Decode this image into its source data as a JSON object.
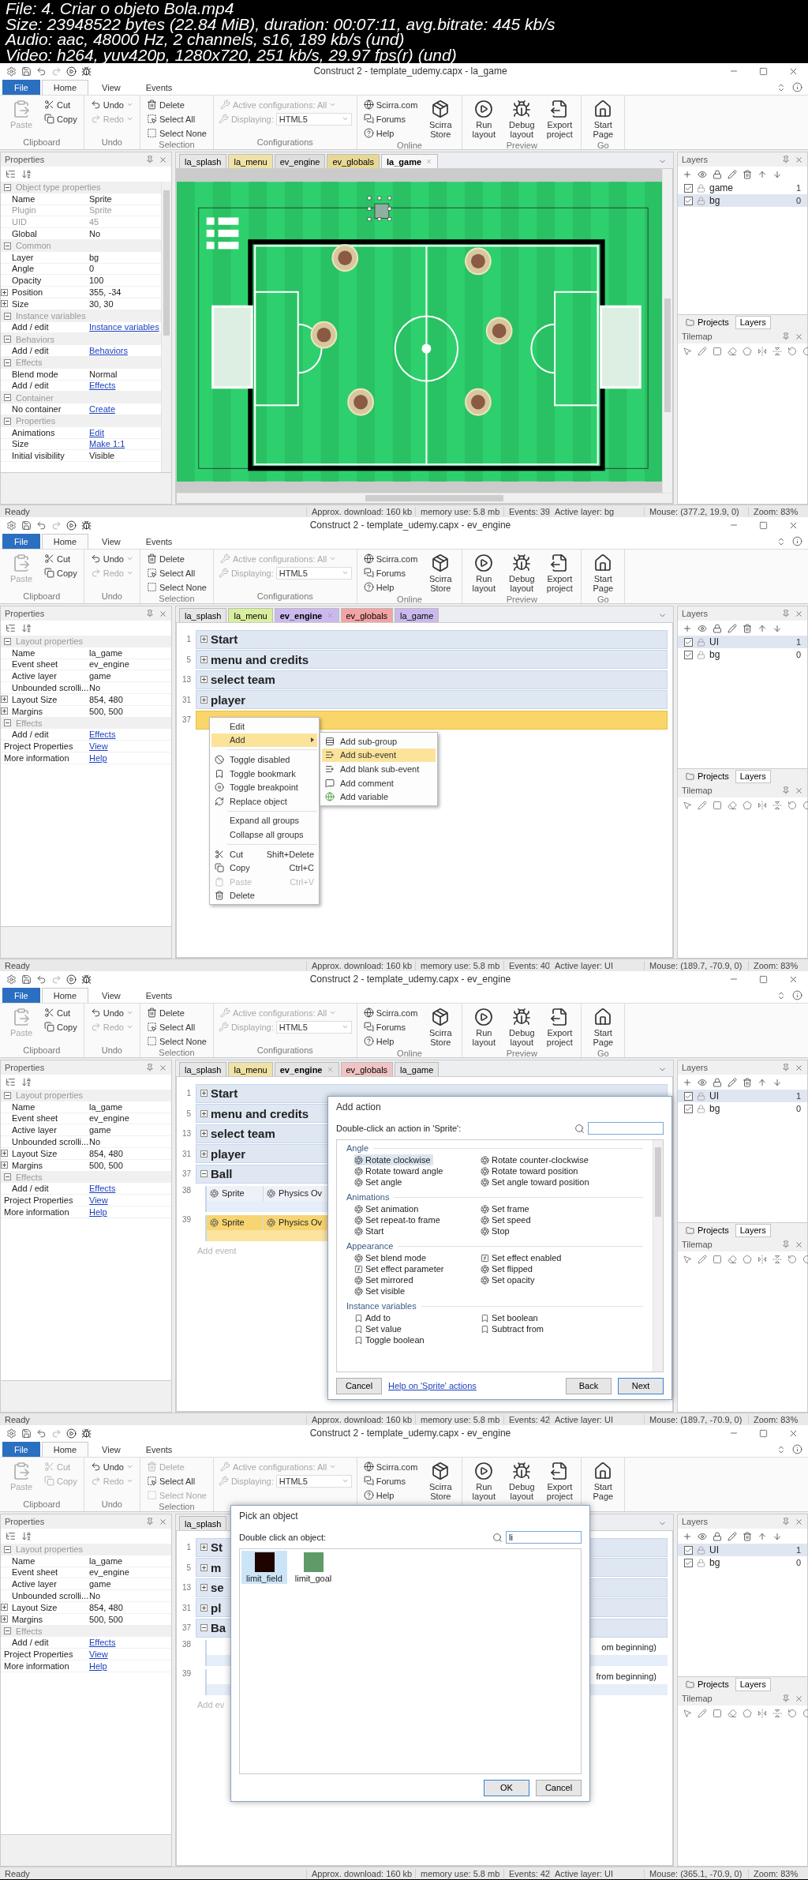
{
  "file_info": [
    "File: 4. Criar o objeto Bola.mp4",
    "Size: 23948522 bytes (22.84 MiB), duration: 00:07:11, avg.bitrate: 445 kb/s",
    "Audio: aac, 48000 Hz, 2 channels, s16, 189 kb/s (und)",
    "Video: h264, yuv420p, 1280x720, 251 kb/s, 29.97 fps(r) (und)"
  ],
  "frames": [
    {
      "window_title": "Construct 2 - template_udemy.capx - la_game",
      "ribbon_tabs": [
        {
          "label": "File",
          "selected": false
        },
        {
          "label": "Home",
          "selected": true
        },
        {
          "label": "View",
          "selected": false
        },
        {
          "label": "Events",
          "selected": false
        }
      ],
      "ribbon": [
        {
          "label": "Clipboard",
          "items": [
            {
              "kind": "large",
              "label": "Paste",
              "disabled": true
            },
            {
              "kind": "small",
              "label": "Cut",
              "disabled": false
            },
            {
              "kind": "small",
              "label": "Copy",
              "disabled": false
            }
          ]
        },
        {
          "label": "Undo",
          "items": [
            {
              "kind": "menu",
              "label": "Undo",
              "disabled": false
            },
            {
              "kind": "menu",
              "label": "Redo",
              "disabled": true
            }
          ]
        },
        {
          "label": "Selection",
          "items": [
            {
              "kind": "small",
              "label": "Delete",
              "disabled": false
            },
            {
              "kind": "small",
              "label": "Select All",
              "disabled": false
            },
            {
              "kind": "small",
              "label": "Select None",
              "disabled": false
            }
          ]
        },
        {
          "label": "Configurations",
          "items": [
            {
              "kind": "menu",
              "label": "Active configurations: All",
              "disabled": true
            },
            {
              "kind": "select",
              "label": "Displaying:",
              "value": "HTML5",
              "disabled": true
            }
          ]
        },
        {
          "label": "Online",
          "items": [
            {
              "kind": "small",
              "label": "Scirra.com",
              "disabled": false
            },
            {
              "kind": "small",
              "label": "Forums",
              "disabled": false
            },
            {
              "kind": "small",
              "label": "Help",
              "disabled": false
            },
            {
              "kind": "large",
              "label": "Scirra Store",
              "disabled": false
            }
          ]
        },
        {
          "label": "Preview",
          "items": [
            {
              "kind": "large",
              "label": "Run layout",
              "disabled": false
            },
            {
              "kind": "large",
              "label": "Debug layout",
              "disabled": false
            },
            {
              "kind": "large",
              "label": "Export project",
              "disabled": false
            }
          ]
        },
        {
          "label": "Go",
          "items": [
            {
              "kind": "large",
              "label": "Start Page",
              "disabled": false
            }
          ]
        }
      ],
      "properties": {
        "title": "Properties",
        "rows": [
          {
            "kind": "section",
            "name": "Object type properties"
          },
          {
            "kind": "row",
            "name": "Name",
            "value": "Sprite"
          },
          {
            "kind": "readonly",
            "name": "Plugin",
            "value": "Sprite"
          },
          {
            "kind": "readonly",
            "name": "UID",
            "value": "45"
          },
          {
            "kind": "row",
            "name": "Global",
            "value": "No"
          },
          {
            "kind": "section",
            "name": "Common"
          },
          {
            "kind": "row",
            "name": "Layer",
            "value": "bg"
          },
          {
            "kind": "row",
            "name": "Angle",
            "value": "0"
          },
          {
            "kind": "row",
            "name": "Opacity",
            "value": "100"
          },
          {
            "kind": "expand",
            "name": "Position",
            "value": "355, -34"
          },
          {
            "kind": "expand",
            "name": "Size",
            "value": "30, 30"
          },
          {
            "kind": "section",
            "name": "Instance variables"
          },
          {
            "kind": "link",
            "name": "Add / edit",
            "value": "Instance variables"
          },
          {
            "kind": "section",
            "name": "Behaviors"
          },
          {
            "kind": "link",
            "name": "Add / edit",
            "value": "Behaviors"
          },
          {
            "kind": "section",
            "name": "Effects"
          },
          {
            "kind": "row",
            "name": "Blend mode",
            "value": "Normal"
          },
          {
            "kind": "link",
            "name": "Add / edit",
            "value": "Effects"
          },
          {
            "kind": "section",
            "name": "Container"
          },
          {
            "kind": "link",
            "name": "No container",
            "value": "Create"
          },
          {
            "kind": "section",
            "name": "Properties"
          },
          {
            "kind": "link",
            "name": "Animations",
            "value": "Edit"
          },
          {
            "kind": "link",
            "name": "Size",
            "value": "Make 1:1"
          },
          {
            "kind": "row",
            "name": "Initial visibility",
            "value": "Visible"
          }
        ]
      },
      "document_tabs": [
        {
          "label": "la_splash",
          "color": "#e6e6e6",
          "selected": false
        },
        {
          "label": "la_menu",
          "color": "#efe2a6",
          "selected": false
        },
        {
          "label": "ev_engine",
          "color": "#dedede",
          "selected": false
        },
        {
          "label": "ev_globals",
          "color": "#e8d896",
          "selected": false
        },
        {
          "label": "la_game",
          "color": "#f7f7f7",
          "selected": true
        }
      ],
      "view": {
        "kind": "layout"
      },
      "layers": {
        "title": "Layers",
        "rows": [
          {
            "name": "game",
            "index": "1",
            "checked": true,
            "selected": false
          },
          {
            "name": "bg",
            "index": "0",
            "checked": true,
            "selected": true
          }
        ],
        "tabs": [
          {
            "label": "Projects",
            "selected": false
          },
          {
            "label": "Layers",
            "selected": true
          }
        ],
        "tilemap": "Tilemap"
      },
      "status": {
        "ready": "Ready",
        "download": "Approx. download: 160 kb",
        "memory": "memory use: 5.8 mb",
        "events": "Events: 39",
        "layer": "Active layer: bg",
        "mouse": "Mouse: (377.2, 19.9, 0)",
        "zoom": "Zoom: 83%"
      }
    },
    {
      "window_title": "Construct 2 - template_udemy.capx - ev_engine",
      "ribbon_tabs": [
        {
          "label": "File",
          "selected": false
        },
        {
          "label": "Home",
          "selected": true
        },
        {
          "label": "View",
          "selected": false
        },
        {
          "label": "Events",
          "selected": false
        }
      ],
      "ribbon": [
        {
          "label": "Clipboard",
          "items": [
            {
              "kind": "large",
              "label": "Paste",
              "disabled": true
            },
            {
              "kind": "small",
              "label": "Cut",
              "disabled": false
            },
            {
              "kind": "small",
              "label": "Copy",
              "disabled": false
            }
          ]
        },
        {
          "label": "Undo",
          "items": [
            {
              "kind": "menu",
              "label": "Undo",
              "disabled": false
            },
            {
              "kind": "menu",
              "label": "Redo",
              "disabled": true
            }
          ]
        },
        {
          "label": "Selection",
          "items": [
            {
              "kind": "small",
              "label": "Delete",
              "disabled": false
            },
            {
              "kind": "small",
              "label": "Select All",
              "disabled": false
            },
            {
              "kind": "small",
              "label": "Select None",
              "disabled": false
            }
          ]
        },
        {
          "label": "Configurations",
          "items": [
            {
              "kind": "menu",
              "label": "Active configurations: All",
              "disabled": true
            },
            {
              "kind": "select",
              "label": "Displaying:",
              "value": "HTML5",
              "disabled": true
            }
          ]
        },
        {
          "label": "Online",
          "items": [
            {
              "kind": "small",
              "label": "Scirra.com",
              "disabled": false
            },
            {
              "kind": "small",
              "label": "Forums",
              "disabled": false
            },
            {
              "kind": "small",
              "label": "Help",
              "disabled": false
            },
            {
              "kind": "large",
              "label": "Scirra Store",
              "disabled": false
            }
          ]
        },
        {
          "label": "Preview",
          "items": [
            {
              "kind": "large",
              "label": "Run layout",
              "disabled": false
            },
            {
              "kind": "large",
              "label": "Debug layout",
              "disabled": false
            },
            {
              "kind": "large",
              "label": "Export project",
              "disabled": false
            }
          ]
        },
        {
          "label": "Go",
          "items": [
            {
              "kind": "large",
              "label": "Start Page",
              "disabled": false
            }
          ]
        }
      ],
      "properties": {
        "title": "Properties",
        "rows": [
          {
            "kind": "section",
            "name": "Layout properties"
          },
          {
            "kind": "row",
            "name": "Name",
            "value": "la_game"
          },
          {
            "kind": "row",
            "name": "Event sheet",
            "value": "ev_engine"
          },
          {
            "kind": "row",
            "name": "Active layer",
            "value": "game"
          },
          {
            "kind": "row",
            "name": "Unbounded scrolli...",
            "value": "No"
          },
          {
            "kind": "expand",
            "name": "Layout Size",
            "value": "854, 480"
          },
          {
            "kind": "expand",
            "name": "Margins",
            "value": "500, 500"
          },
          {
            "kind": "section",
            "name": "Effects"
          },
          {
            "kind": "link",
            "name": "Add / edit",
            "value": "Effects"
          },
          {
            "kind": "toplink",
            "name": "Project Properties",
            "value": "View"
          },
          {
            "kind": "toplink",
            "name": "More information",
            "value": "Help"
          }
        ]
      },
      "document_tabs": [
        {
          "label": "la_splash",
          "color": "#e6e6e6",
          "selected": false
        },
        {
          "label": "la_menu",
          "color": "#d8ef9e",
          "selected": false
        },
        {
          "label": "ev_engine",
          "color": "#cbb9ee",
          "selected": true
        },
        {
          "label": "ev_globals",
          "color": "#f2a3a3",
          "selected": false
        },
        {
          "label": "la_game",
          "color": "#cbb9ee",
          "selected": false
        }
      ],
      "view": {
        "kind": "events",
        "events": [
          {
            "kind": "group",
            "line": "1",
            "title": "Start",
            "expanded": false,
            "selected": false
          },
          {
            "kind": "group",
            "line": "5",
            "title": "menu and credits",
            "expanded": false,
            "selected": false
          },
          {
            "kind": "group",
            "line": "13",
            "title": "select team",
            "expanded": false,
            "selected": false
          },
          {
            "kind": "group",
            "line": "31",
            "title": "player",
            "expanded": false,
            "selected": false
          },
          {
            "kind": "group",
            "line": "37",
            "selected": true
          }
        ]
      },
      "context_menu": {
        "items": [
          {
            "kind": "item",
            "label": "Edit",
            "selected": false,
            "disabled": false
          },
          {
            "kind": "submenu",
            "label": "Add",
            "selected": true,
            "disabled": false
          },
          {
            "kind": "separator"
          },
          {
            "kind": "item",
            "label": "Toggle disabled",
            "selected": false,
            "disabled": false
          },
          {
            "kind": "item",
            "label": "Toggle bookmark",
            "selected": false,
            "disabled": false
          },
          {
            "kind": "item",
            "label": "Toggle breakpoint",
            "selected": false,
            "disabled": false
          },
          {
            "kind": "item",
            "label": "Replace object",
            "selected": false,
            "disabled": false
          },
          {
            "kind": "separator"
          },
          {
            "kind": "item",
            "label": "Expand all groups",
            "selected": false,
            "disabled": false
          },
          {
            "kind": "item",
            "label": "Collapse all groups",
            "selected": false,
            "disabled": false
          },
          {
            "kind": "separator"
          },
          {
            "kind": "item",
            "label": "Cut",
            "shortcut": "Shift+Delete",
            "selected": false,
            "disabled": false
          },
          {
            "kind": "item",
            "label": "Copy",
            "shortcut": "Ctrl+C",
            "selected": false,
            "disabled": false
          },
          {
            "kind": "item",
            "label": "Paste",
            "shortcut": "Ctrl+V",
            "selected": false,
            "disabled": true
          },
          {
            "kind": "item",
            "label": "Delete",
            "selected": false,
            "disabled": false
          }
        ],
        "submenu": [
          {
            "label": "Add sub-group",
            "selected": false
          },
          {
            "label": "Add sub-event",
            "selected": true
          },
          {
            "label": "Add blank sub-event",
            "selected": false
          },
          {
            "label": "Add comment",
            "selected": false
          },
          {
            "label": "Add variable",
            "selected": false
          }
        ]
      },
      "layers": {
        "title": "Layers",
        "rows": [
          {
            "name": "UI",
            "index": "1",
            "checked": true,
            "selected": true
          },
          {
            "name": "bg",
            "index": "0",
            "checked": true,
            "selected": false
          }
        ],
        "tabs": [
          {
            "label": "Projects",
            "selected": false
          },
          {
            "label": "Layers",
            "selected": true
          }
        ],
        "tilemap": "Tilemap"
      },
      "status": {
        "ready": "Ready",
        "download": "Approx. download: 160 kb",
        "memory": "memory use: 5.8 mb",
        "events": "Events: 40",
        "layer": "Active layer: UI",
        "mouse": "Mouse: (189.7, -70.9, 0)",
        "zoom": "Zoom: 83%"
      }
    },
    {
      "window_title": "Construct 2 - template_udemy.capx - ev_engine",
      "ribbon_tabs": [
        {
          "label": "File",
          "selected": false
        },
        {
          "label": "Home",
          "selected": true
        },
        {
          "label": "View",
          "selected": false
        },
        {
          "label": "Events",
          "selected": false
        }
      ],
      "ribbon": [
        {
          "label": "Clipboard",
          "items": [
            {
              "kind": "large",
              "label": "Paste",
              "disabled": true
            },
            {
              "kind": "small",
              "label": "Cut",
              "disabled": false
            },
            {
              "kind": "small",
              "label": "Copy",
              "disabled": false
            }
          ]
        },
        {
          "label": "Undo",
          "items": [
            {
              "kind": "menu",
              "label": "Undo",
              "disabled": false
            },
            {
              "kind": "menu",
              "label": "Redo",
              "disabled": true
            }
          ]
        },
        {
          "label": "Selection",
          "items": [
            {
              "kind": "small",
              "label": "Delete",
              "disabled": false
            },
            {
              "kind": "small",
              "label": "Select All",
              "disabled": false
            },
            {
              "kind": "small",
              "label": "Select None",
              "disabled": false
            }
          ]
        },
        {
          "label": "Configurations",
          "items": [
            {
              "kind": "menu",
              "label": "Active configurations: All",
              "disabled": true
            },
            {
              "kind": "select",
              "label": "Displaying:",
              "value": "HTML5",
              "disabled": true
            }
          ]
        },
        {
          "label": "Online",
          "items": [
            {
              "kind": "small",
              "label": "Scirra.com",
              "disabled": false
            },
            {
              "kind": "small",
              "label": "Forums",
              "disabled": false
            },
            {
              "kind": "small",
              "label": "Help",
              "disabled": false
            },
            {
              "kind": "large",
              "label": "Scirra Store",
              "disabled": false
            }
          ]
        },
        {
          "label": "Preview",
          "items": [
            {
              "kind": "large",
              "label": "Run layout",
              "disabled": false
            },
            {
              "kind": "large",
              "label": "Debug layout",
              "disabled": false
            },
            {
              "kind": "large",
              "label": "Export project",
              "disabled": false
            }
          ]
        },
        {
          "label": "Go",
          "items": [
            {
              "kind": "large",
              "label": "Start Page",
              "disabled": false
            }
          ]
        }
      ],
      "properties": {
        "title": "Properties",
        "rows": [
          {
            "kind": "section",
            "name": "Layout properties"
          },
          {
            "kind": "row",
            "name": "Name",
            "value": "la_game"
          },
          {
            "kind": "row",
            "name": "Event sheet",
            "value": "ev_engine"
          },
          {
            "kind": "row",
            "name": "Active layer",
            "value": "game"
          },
          {
            "kind": "row",
            "name": "Unbounded scrolli...",
            "value": "No"
          },
          {
            "kind": "expand",
            "name": "Layout Size",
            "value": "854, 480"
          },
          {
            "kind": "expand",
            "name": "Margins",
            "value": "500, 500"
          },
          {
            "kind": "section",
            "name": "Effects"
          },
          {
            "kind": "link",
            "name": "Add / edit",
            "value": "Effects"
          },
          {
            "kind": "toplink",
            "name": "Project Properties",
            "value": "View"
          },
          {
            "kind": "toplink",
            "name": "More information",
            "value": "Help"
          }
        ]
      },
      "document_tabs": [
        {
          "label": "la_splash",
          "color": "#e6e6e6",
          "selected": false
        },
        {
          "label": "la_menu",
          "color": "#efe2a6",
          "selected": false
        },
        {
          "label": "ev_engine",
          "color": "#e4e4e4",
          "selected": true
        },
        {
          "label": "ev_globals",
          "color": "#f0c4c4",
          "selected": false
        },
        {
          "label": "la_game",
          "color": "#e6e6e6",
          "selected": false
        }
      ],
      "view": {
        "kind": "events",
        "events": [
          {
            "kind": "group",
            "line": "1",
            "title": "Start",
            "expanded": false,
            "selected": false
          },
          {
            "kind": "group",
            "line": "5",
            "title": "menu and credits",
            "expanded": false,
            "selected": false
          },
          {
            "kind": "group",
            "line": "13",
            "title": "select team",
            "expanded": false,
            "selected": false
          },
          {
            "kind": "group",
            "line": "31",
            "title": "player",
            "expanded": false,
            "selected": false
          },
          {
            "kind": "group",
            "line": "37",
            "title": "Ball",
            "expanded": true,
            "selected": false
          },
          {
            "kind": "event",
            "line": "38",
            "object": "Sprite",
            "condition": "Physics Ov",
            "selected": false
          },
          {
            "kind": "event",
            "line": "39",
            "object": "Sprite",
            "condition": "Physics Ov",
            "selected": true
          },
          {
            "kind": "add",
            "label": "Add event"
          }
        ]
      },
      "dialog": {
        "kind": "add-action",
        "title": "Add action",
        "prompt": "Double-click an action in 'Sprite':",
        "sections": [
          {
            "title": "Angle",
            "items": [
              {
                "kind": "action",
                "label": "Rotate clockwise",
                "selected": true
              },
              {
                "kind": "action",
                "label": "Rotate counter-clockwise",
                "selected": false
              },
              {
                "kind": "action",
                "label": "Rotate toward angle",
                "selected": false
              },
              {
                "kind": "action",
                "label": "Rotate toward position",
                "selected": false
              },
              {
                "kind": "action",
                "label": "Set angle",
                "selected": false
              },
              {
                "kind": "action",
                "label": "Set angle toward position",
                "selected": false
              }
            ]
          },
          {
            "title": "Animations",
            "items": [
              {
                "kind": "action",
                "label": "Set animation",
                "selected": false
              },
              {
                "kind": "action",
                "label": "Set frame",
                "selected": false
              },
              {
                "kind": "action",
                "label": "Set repeat-to frame",
                "selected": false
              },
              {
                "kind": "action",
                "label": "Set speed",
                "selected": false
              },
              {
                "kind": "action",
                "label": "Start",
                "selected": false
              },
              {
                "kind": "action",
                "label": "Stop",
                "selected": false
              }
            ]
          },
          {
            "title": "Appearance",
            "items": [
              {
                "kind": "action",
                "label": "Set blend mode",
                "selected": false
              },
              {
                "kind": "effect",
                "label": "Set effect enabled",
                "selected": false
              },
              {
                "kind": "effect",
                "label": "Set effect parameter",
                "selected": false
              },
              {
                "kind": "action",
                "label": "Set flipped",
                "selected": false
              },
              {
                "kind": "action",
                "label": "Set mirrored",
                "selected": false
              },
              {
                "kind": "action",
                "label": "Set opacity",
                "selected": false
              },
              {
                "kind": "action",
                "label": "Set visible",
                "selected": false
              }
            ]
          },
          {
            "title": "Instance variables",
            "items": [
              {
                "kind": "variable",
                "label": "Add to",
                "selected": false
              },
              {
                "kind": "variable",
                "label": "Set boolean",
                "selected": false
              },
              {
                "kind": "variable",
                "label": "Set value",
                "selected": false
              },
              {
                "kind": "variable",
                "label": "Subtract from",
                "selected": false
              },
              {
                "kind": "variable",
                "label": "Toggle boolean",
                "selected": false
              }
            ]
          }
        ],
        "buttons": [
          {
            "kind": "button",
            "label": "Cancel"
          },
          {
            "kind": "link",
            "label": "Help on 'Sprite' actions"
          },
          {
            "kind": "button",
            "label": "Back"
          },
          {
            "kind": "default",
            "label": "Next"
          }
        ]
      },
      "layers": {
        "title": "Layers",
        "rows": [
          {
            "name": "UI",
            "index": "1",
            "checked": true,
            "selected": true
          },
          {
            "name": "bg",
            "index": "0",
            "checked": true,
            "selected": false
          }
        ],
        "tabs": [
          {
            "label": "Projects",
            "selected": false
          },
          {
            "label": "Layers",
            "selected": true
          }
        ],
        "tilemap": "Tilemap"
      },
      "status": {
        "ready": "Ready",
        "download": "Approx. download: 160 kb",
        "memory": "memory use: 5.8 mb",
        "events": "Events: 42",
        "layer": "Active layer: UI",
        "mouse": "Mouse: (189.7, -70.9, 0)",
        "zoom": "Zoom: 83%"
      }
    },
    {
      "window_title": "Construct 2 - template_udemy.capx - ev_engine",
      "ribbon_tabs": [
        {
          "label": "File",
          "selected": false
        },
        {
          "label": "Home",
          "selected": true
        },
        {
          "label": "View",
          "selected": false
        },
        {
          "label": "Events",
          "selected": false
        }
      ],
      "ribbon": [
        {
          "label": "Clipboard",
          "items": [
            {
              "kind": "large",
              "label": "Paste",
              "disabled": true
            },
            {
              "kind": "small",
              "label": "Cut",
              "disabled": true
            },
            {
              "kind": "small",
              "label": "Copy",
              "disabled": true
            }
          ]
        },
        {
          "label": "Undo",
          "items": [
            {
              "kind": "menu",
              "label": "Undo",
              "disabled": false
            },
            {
              "kind": "menu",
              "label": "Redo",
              "disabled": true
            }
          ]
        },
        {
          "label": "Selection",
          "items": [
            {
              "kind": "small",
              "label": "Delete",
              "disabled": true
            },
            {
              "kind": "small",
              "label": "Select All",
              "disabled": false
            },
            {
              "kind": "small",
              "label": "Select None",
              "disabled": true
            }
          ]
        },
        {
          "items": [
            {
              "kind": "menu",
              "label": "Active configurations: All",
              "disabled": true
            },
            {
              "kind": "select",
              "label": "Displaying:",
              "value": "HTML5",
              "disabled": true
            }
          ]
        },
        {
          "items": [
            {
              "kind": "small",
              "label": "Scirra.com",
              "disabled": false
            },
            {
              "kind": "small",
              "label": "Forums",
              "disabled": false
            },
            {
              "kind": "small",
              "label": "Help",
              "disabled": false
            },
            {
              "kind": "large",
              "label": "Scirra Store",
              "disabled": false
            }
          ]
        },
        {
          "items": [
            {
              "kind": "large",
              "label": "Run layout",
              "disabled": false
            },
            {
              "kind": "large",
              "label": "Debug layout",
              "disabled": false
            },
            {
              "kind": "large",
              "label": "Export project",
              "disabled": false
            }
          ]
        },
        {
          "items": [
            {
              "kind": "large",
              "label": "Start Page",
              "disabled": false
            }
          ]
        }
      ],
      "properties": {
        "title": "Properties",
        "rows": [
          {
            "kind": "section",
            "name": "Layout properties"
          },
          {
            "kind": "row",
            "name": "Name",
            "value": "la_game"
          },
          {
            "kind": "row",
            "name": "Event sheet",
            "value": "ev_engine"
          },
          {
            "kind": "row",
            "name": "Active layer",
            "value": "game"
          },
          {
            "kind": "row",
            "name": "Unbounded scrolli...",
            "value": "No"
          },
          {
            "kind": "expand",
            "name": "Layout Size",
            "value": "854, 480"
          },
          {
            "kind": "expand",
            "name": "Margins",
            "value": "500, 500"
          },
          {
            "kind": "section",
            "name": "Effects"
          },
          {
            "kind": "link",
            "name": "Add / edit",
            "value": "Effects"
          },
          {
            "kind": "toplink",
            "name": "Project Properties",
            "value": "View"
          },
          {
            "kind": "toplink",
            "name": "More information",
            "value": "Help"
          }
        ]
      },
      "document_tabs": [
        {
          "label": "la_splash",
          "color": "#e6e6e6",
          "selected": false
        }
      ],
      "view": {
        "kind": "events",
        "events": [
          {
            "kind": "group",
            "line": "1",
            "title": "St",
            "expanded": false,
            "selected": false
          },
          {
            "kind": "group",
            "line": "5",
            "title": "m",
            "expanded": false,
            "selected": false
          },
          {
            "kind": "group",
            "line": "13",
            "title": "se",
            "expanded": false,
            "selected": false
          },
          {
            "kind": "group",
            "line": "31",
            "title": "pl",
            "expanded": false,
            "selected": false
          },
          {
            "kind": "group",
            "line": "37",
            "title": "Ba",
            "expanded": true,
            "selected": false
          },
          {
            "kind": "event",
            "line": "38",
            "action": "om beginning)",
            "selected": false
          },
          {
            "kind": "event",
            "line": "39",
            "action": "from beginning)",
            "selected": false
          },
          {
            "kind": "add",
            "label": "Add ev"
          }
        ]
      },
      "dialog": {
        "kind": "pick-object",
        "title": "Pick an object",
        "prompt": "Double click an object:",
        "search": "li",
        "objects": [
          {
            "label": "limit_field",
            "color": "#1e0400",
            "selected": true
          },
          {
            "label": "limit_goal",
            "color": "#5f9a68",
            "selected": false
          }
        ],
        "buttons": [
          {
            "kind": "default",
            "label": "OK"
          },
          {
            "kind": "button",
            "label": "Cancel"
          }
        ]
      },
      "layers": {
        "title": "Layers",
        "rows": [
          {
            "name": "UI",
            "index": "1",
            "checked": true,
            "selected": true
          },
          {
            "name": "bg",
            "index": "0",
            "checked": true,
            "selected": false
          }
        ],
        "tabs": [
          {
            "label": "Projects",
            "selected": false
          },
          {
            "label": "Layers",
            "selected": true
          }
        ],
        "tilemap": "Tilemap"
      },
      "status": {
        "ready": "Ready",
        "download": "Approx. download: 160 kb",
        "memory": "memory use: 5.8 mb",
        "events": "Events: 42",
        "layer": "Active layer: UI",
        "mouse": "Mouse: (365.1, -70.9, 0)",
        "zoom": "Zoom: 83%"
      }
    }
  ]
}
